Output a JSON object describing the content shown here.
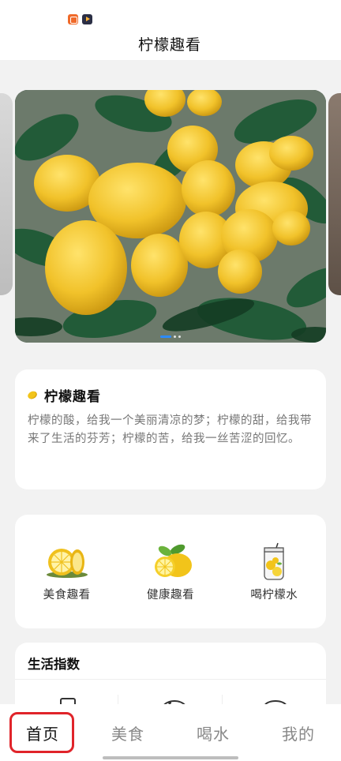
{
  "header": {
    "title": "柠檬趣看"
  },
  "banner": {
    "dots": 3,
    "active_dot": 0
  },
  "intro": {
    "title": "柠檬趣看",
    "text": "柠檬的酸，给我一个美丽清凉的梦；柠檬的甜，给我带来了生活的芬芳；柠檬的苦，给我一丝苦涩的回忆。"
  },
  "categories": [
    {
      "label": "美食趣看",
      "icon": "lemon-slices-icon"
    },
    {
      "label": "健康趣看",
      "icon": "lemon-leaf-icon"
    },
    {
      "label": "喝柠檬水",
      "icon": "lemon-water-jar-icon"
    }
  ],
  "life": {
    "title": "生活指数"
  },
  "tabs": [
    {
      "label": "首页",
      "active": true
    },
    {
      "label": "美食",
      "active": false
    },
    {
      "label": "喝水",
      "active": false
    },
    {
      "label": "我的",
      "active": false
    }
  ],
  "colors": {
    "accent": "#2c8bff",
    "highlight": "#e0242a",
    "lemon": "#f2c41a"
  }
}
